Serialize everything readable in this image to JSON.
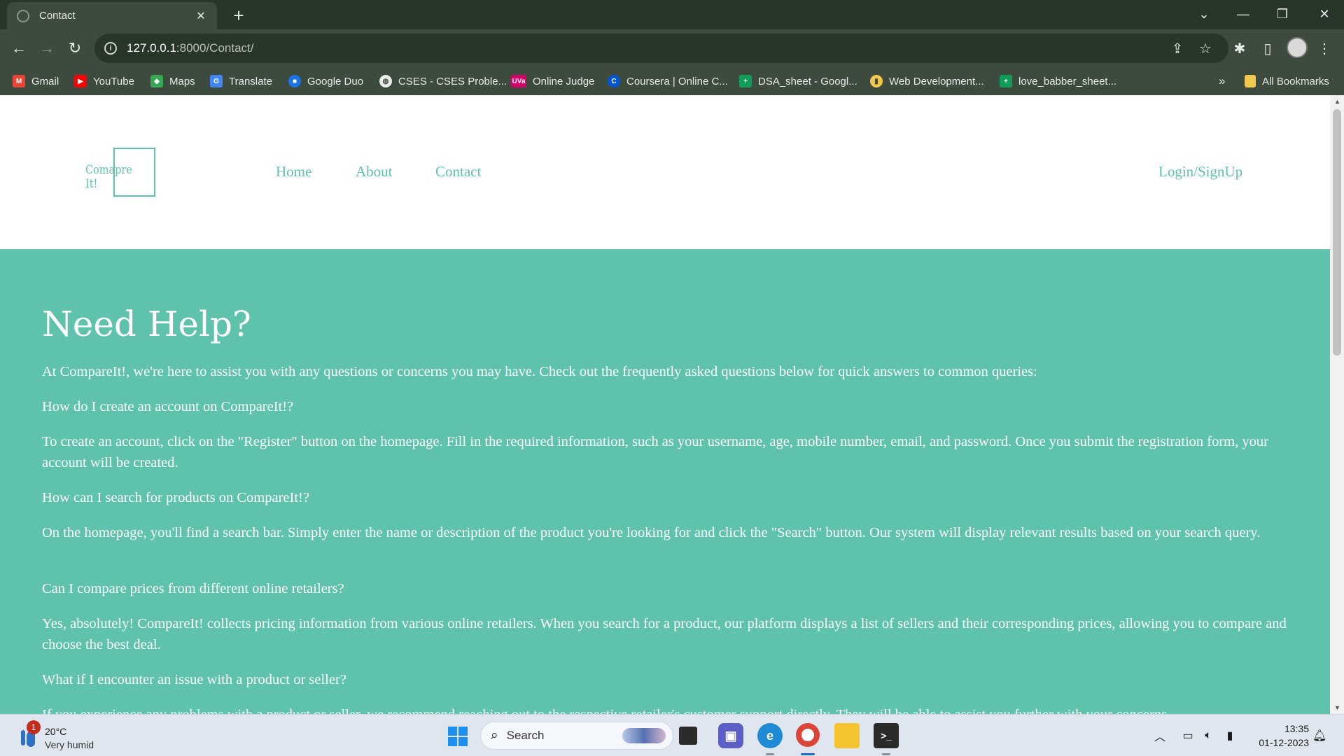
{
  "browser": {
    "tab_title": "Contact",
    "url_host": "127.0.0.1",
    "url_rest": ":8000/Contact/",
    "bookmarks": [
      {
        "label": "Gmail",
        "icon": "gmail-icon",
        "color": "#ea4335"
      },
      {
        "label": "YouTube",
        "icon": "youtube-icon",
        "color": "#ff0000"
      },
      {
        "label": "Maps",
        "icon": "maps-icon",
        "color": "#34a853"
      },
      {
        "label": "Translate",
        "icon": "translate-icon",
        "color": "#4285f4"
      },
      {
        "label": "Google Duo",
        "icon": "duo-icon",
        "color": "#1a73e8"
      },
      {
        "label": "CSES - CSES Proble...",
        "icon": "globe-icon",
        "color": "#e8ece8"
      },
      {
        "label": "Online Judge",
        "icon": "uva-icon",
        "color": "#d6006a"
      },
      {
        "label": "Coursera | Online C...",
        "icon": "coursera-icon",
        "color": "#0056d2"
      },
      {
        "label": "DSA_sheet - Googl...",
        "icon": "sheets-icon",
        "color": "#0f9d58"
      },
      {
        "label": "Web Development...",
        "icon": "webdev-icon",
        "color": "#f2c94c"
      },
      {
        "label": "love_babber_sheet...",
        "icon": "sheets-icon",
        "color": "#0f9d58"
      }
    ],
    "more_bookmarks": "»",
    "all_bookmarks": "All Bookmarks"
  },
  "site": {
    "logo_text": "Comapre It!",
    "nav": [
      "Home",
      "About",
      "Contact"
    ],
    "login": "Login/SignUp",
    "accent": "#5ec2ad"
  },
  "content": {
    "heading": "Need Help?",
    "paragraphs": [
      "At CompareIt!, we're here to assist you with any questions or concerns you may have. Check out the frequently asked questions below for quick answers to common queries:",
      "How do I create an account on CompareIt!?",
      "To create an account, click on the \"Register\" button on the homepage. Fill in the required information, such as your username, age, mobile number, email, and password. Once you submit the registration form, your account will be created.",
      "How can I search for products on CompareIt!?",
      "On the homepage, you'll find a search bar. Simply enter the name or description of the product you're looking for and click the \"Search\" button. Our system will display relevant results based on your search query.",
      "Can I compare prices from different online retailers?",
      "Yes, absolutely! CompareIt! collects pricing information from various online retailers. When you search for a product, our platform displays a list of sellers and their corresponding prices, allowing you to compare and choose the best deal.",
      "What if I encounter an issue with a product or seller?",
      "If you experience any problems with a product or seller, we recommend reaching out to the respective retailer's customer support directly. They will be able to assist you further with your concerns."
    ]
  },
  "taskbar": {
    "weather_temp": "20°C",
    "weather_cond": "Very humid",
    "weather_badge": "1",
    "search_label": "Search",
    "time": "13:35",
    "date": "01-12-2023"
  }
}
